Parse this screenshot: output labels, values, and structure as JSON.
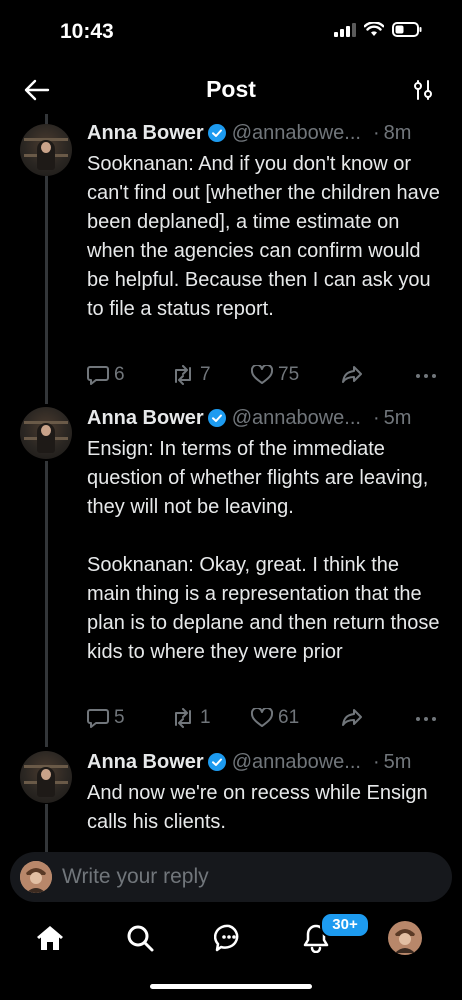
{
  "status_bar": {
    "time": "10:43"
  },
  "header": {
    "title": "Post"
  },
  "posts": [
    {
      "author": "Anna Bower",
      "handle": "@annabowe...",
      "separator": "·",
      "time": "8m",
      "paragraphs": [
        "Sooknanan: And if you don't know or can't find out [whether the children have been deplaned], a time estimate on when the agencies can confirm would be helpful. Because then I can ask you to file a status report."
      ],
      "replies": "6",
      "reposts": "7",
      "likes": "75"
    },
    {
      "author": "Anna Bower",
      "handle": "@annabowe...",
      "separator": "·",
      "time": "5m",
      "paragraphs": [
        "Ensign: In terms of the immediate question of whether flights are leaving, they will not be leaving.",
        "Sooknanan: Okay, great. I think the main thing is a representation that the plan is to deplane and then return those kids to where they were prior"
      ],
      "replies": "5",
      "reposts": "1",
      "likes": "61"
    },
    {
      "author": "Anna Bower",
      "handle": "@annabowe...",
      "separator": "·",
      "time": "5m",
      "paragraphs": [
        "And now we're on recess while Ensign calls his clients."
      ]
    }
  ],
  "reply_bar": {
    "placeholder": "Write your reply"
  },
  "tab_bar": {
    "notifications_badge": "30+"
  },
  "colors": {
    "background": "#000000",
    "text": "#e7e9ea",
    "muted": "#71767b",
    "accent": "#1d9bf0"
  }
}
